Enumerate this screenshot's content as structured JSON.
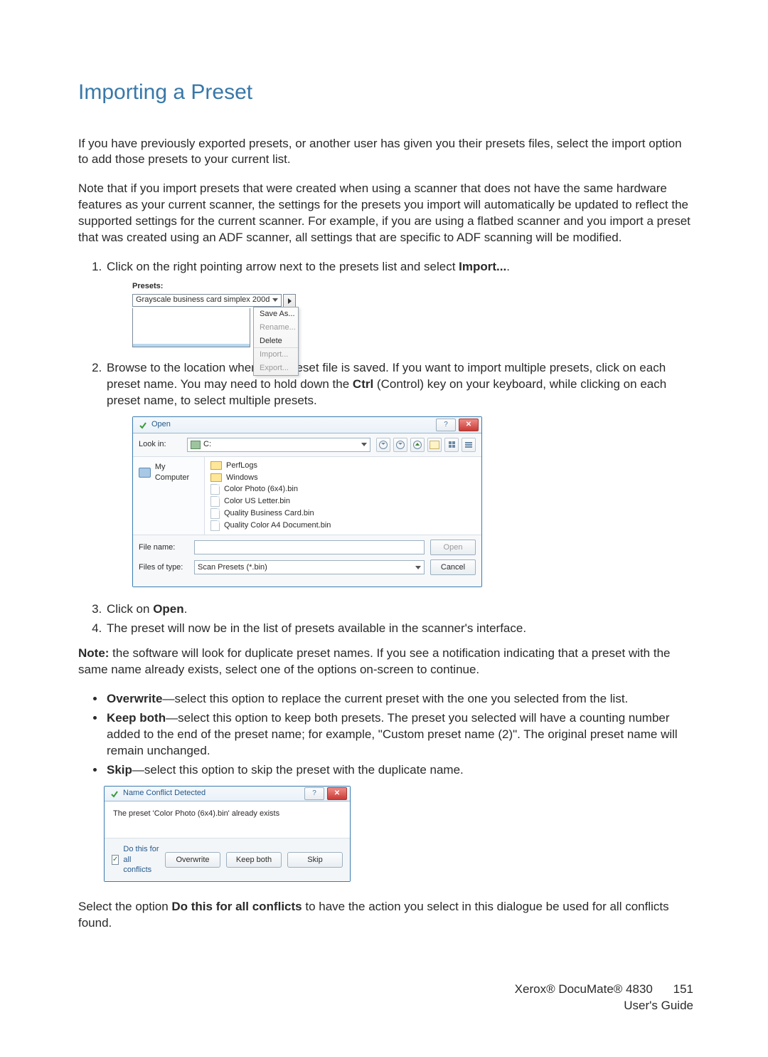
{
  "heading": "Importing a Preset",
  "intro": "If you have previously exported presets, or another user has given you their presets files, select the import option to add those presets to your current list.",
  "note_import": "Note that if you import presets that were created when using a scanner that does not have the same hardware features as your current scanner, the settings for the presets you import will automatically be updated to reflect the supported settings for the current scanner. For example, if you are using a flatbed scanner and you import a preset that was created using an ADF scanner, all settings that are specific to ADF scanning will be modified.",
  "step1": {
    "pre": "Click on the right pointing arrow next to the presets list and select ",
    "bold": "Import...",
    "post": "."
  },
  "step2": {
    "pre": "Browse to the location where the preset file is saved. If you want to import multiple presets, click on each preset name. You may need to hold down the ",
    "bold": "Ctrl",
    "post": " (Control) key on your keyboard, while clicking on each preset name, to select multiple presets."
  },
  "step3": {
    "pre": "Click on ",
    "bold": "Open",
    "post": "."
  },
  "step4": "The preset will now be in the list of presets available in the scanner's interface.",
  "dup_note": {
    "bold": "Note:",
    "post": " the software will look for duplicate preset names. If you see a notification indicating that a preset with the same name already exists, select one of the options on-screen to continue."
  },
  "bullets": {
    "overwrite": {
      "bold": "Overwrite",
      "post": "—select this option to replace the current preset with the one you selected from the list."
    },
    "keepboth": {
      "bold": "Keep both",
      "post": "—select this option to keep both presets. The preset you selected will have a counting number added to the end of the preset name; for example, \"Custom preset name (2)\". The original preset name will remain unchanged."
    },
    "skip": {
      "bold": "Skip",
      "post": "—select this option to skip the preset with the duplicate name."
    }
  },
  "final": {
    "pre": "Select the option ",
    "bold": "Do this for all conflicts",
    "post": " to have the action you select in this dialogue be used for all conflicts found."
  },
  "presets_ui": {
    "label": "Presets:",
    "selected": "Grayscale business card simplex 200d",
    "menu": [
      "Save As...",
      "Rename...",
      "Delete",
      "Import...",
      "Export..."
    ]
  },
  "open_dialog": {
    "title": "Open",
    "look_in_label": "Look in:",
    "look_in_value": "C:",
    "places": [
      "My Computer"
    ],
    "files": [
      {
        "type": "folder",
        "name": "PerfLogs"
      },
      {
        "type": "folder",
        "name": "Windows"
      },
      {
        "type": "file",
        "name": "Color Photo (6x4).bin"
      },
      {
        "type": "file",
        "name": "Color US Letter.bin"
      },
      {
        "type": "file",
        "name": "Quality Business Card.bin"
      },
      {
        "type": "file",
        "name": "Quality Color A4 Document.bin"
      }
    ],
    "file_name_label": "File name:",
    "file_name_value": "",
    "files_of_type_label": "Files of type:",
    "files_of_type_value": "Scan Presets (*.bin)",
    "open_btn": "Open",
    "cancel_btn": "Cancel"
  },
  "conflict_dialog": {
    "title": "Name Conflict Detected",
    "message": "The preset 'Color Photo (6x4).bin' already exists",
    "checkbox_label": "Do this for all conflicts",
    "checked": true,
    "buttons": [
      "Overwrite",
      "Keep both",
      "Skip"
    ]
  },
  "footer": {
    "product": "Xerox® DocuMate® 4830",
    "guide": "User's Guide",
    "page": "151"
  }
}
